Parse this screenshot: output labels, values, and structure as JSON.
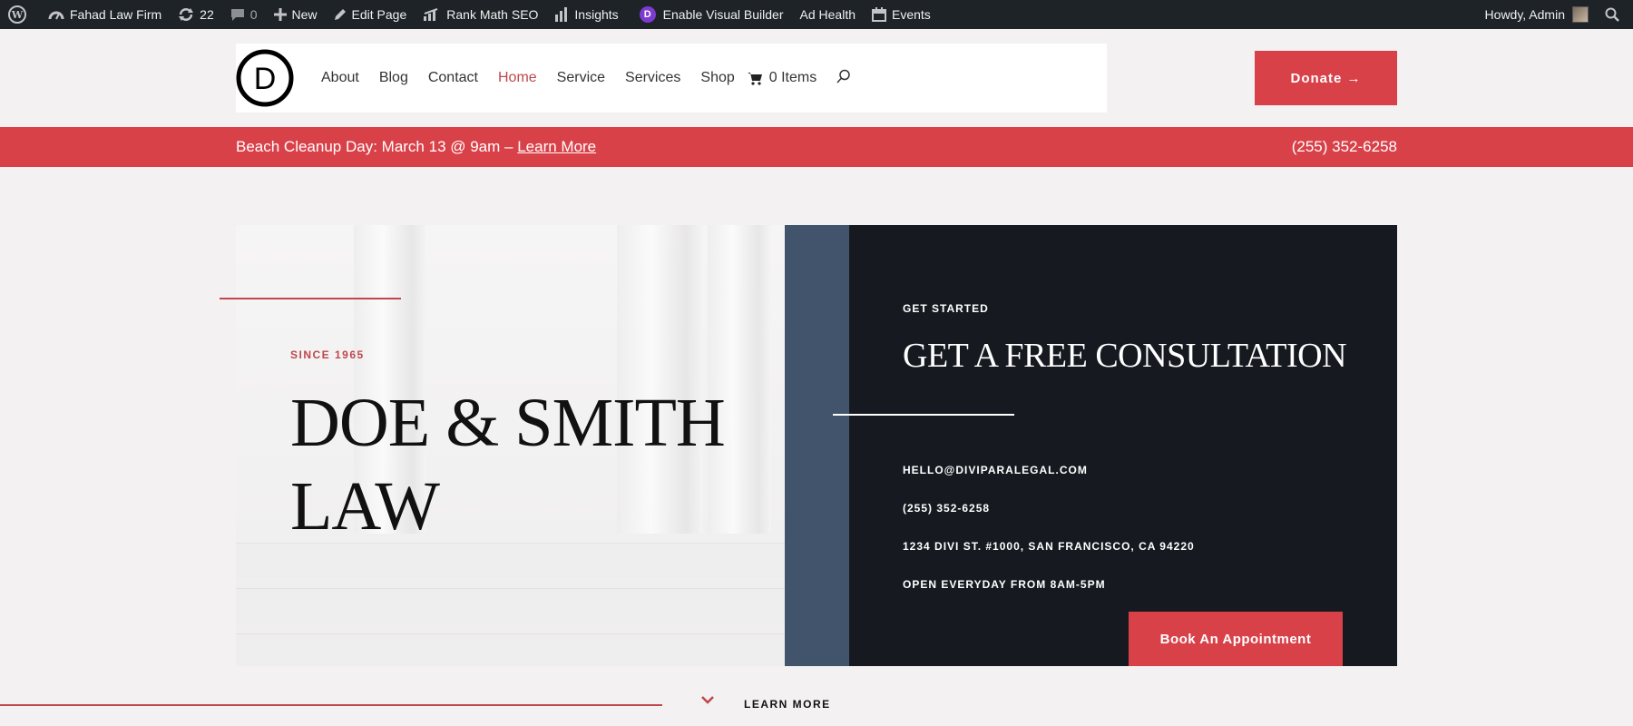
{
  "adminbar": {
    "site_name": "Fahad Law Firm",
    "updates_count": "22",
    "comments_count": "0",
    "new_label": "New",
    "edit_page_label": "Edit Page",
    "rank_math_label": "Rank Math SEO",
    "insights_label": "Insights",
    "divi_badge": "D",
    "visual_builder_label": "Enable Visual Builder",
    "ad_health_label": "Ad Health",
    "events_label": "Events",
    "greeting": "Howdy, Admin"
  },
  "header": {
    "logo_letter": "D",
    "nav": [
      "About",
      "Blog",
      "Contact",
      "Home",
      "Service",
      "Services",
      "Shop"
    ],
    "active_nav": "Home",
    "cart_label": "0 Items",
    "donate_label": "Donate →"
  },
  "announcement": {
    "text": "Beach Cleanup Day: March 13 @ 9am –",
    "link": "Learn More",
    "phone": "(255) 352-6258"
  },
  "hero": {
    "since": "SINCE 1965",
    "title_line1": "DOE & SMITH",
    "title_line2": "LAW"
  },
  "consultation": {
    "kicker": "GET STARTED",
    "title": "GET A FREE CONSULTATION",
    "email": "HELLO@DIVIPARALEGAL.COM",
    "phone": "(255) 352-6258",
    "address": "1234 DIVI ST. #1000, SAN FRANCISCO, CA 94220",
    "hours": "OPEN EVERYDAY FROM 8AM-5PM",
    "button": "Book An Appointment"
  },
  "footer_cta": {
    "learn_more": "LEARN MORE"
  },
  "colors": {
    "accent_red": "#d94149",
    "dark_panel": "#161a20",
    "slate_blue": "#41546b",
    "admin_bar": "#1d2327"
  }
}
